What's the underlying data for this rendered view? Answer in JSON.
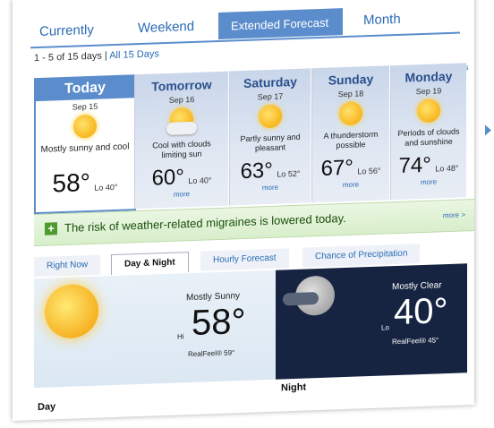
{
  "top_tabs": {
    "currently": "Currently",
    "weekend": "Weekend",
    "extended": "Extended Forecast",
    "month": "Month"
  },
  "subheader": {
    "range": "1 - 5 of 15 days",
    "sep": "|",
    "all": "All 15 Days"
  },
  "next5": "Next 5 days >",
  "days": [
    {
      "name": "Today",
      "date": "Sep 15",
      "desc": "Mostly sunny and cool",
      "hi": "58°",
      "lo": "Lo 40°",
      "more": ""
    },
    {
      "name": "Tomorrow",
      "date": "Sep 16",
      "desc": "Cool with clouds limiting sun",
      "hi": "60°",
      "lo": "Lo 40°",
      "more": "more"
    },
    {
      "name": "Saturday",
      "date": "Sep 17",
      "desc": "Partly sunny and pleasant",
      "hi": "63°",
      "lo": "Lo 52°",
      "more": "more"
    },
    {
      "name": "Sunday",
      "date": "Sep 18",
      "desc": "A thunderstorm possible",
      "hi": "67°",
      "lo": "Lo 56°",
      "more": "more"
    },
    {
      "name": "Monday",
      "date": "Sep 19",
      "desc": "Periods of clouds and sunshine",
      "hi": "74°",
      "lo": "Lo 48°",
      "more": "more"
    }
  ],
  "banner": {
    "plus": "+",
    "text": "The risk of weather-related migraines is lowered today.",
    "more": "more >"
  },
  "lower_tabs": [
    "Right Now",
    "Day & Night",
    "Hourly Forecast",
    "Chance of Precipitation"
  ],
  "day": {
    "cond": "Mostly Sunny",
    "hi_label": "Hi",
    "temp": "58°",
    "realfeel": "RealFeel® 59°",
    "label": "Day"
  },
  "night": {
    "cond": "Mostly Clear",
    "lo_label": "Lo",
    "temp": "40°",
    "realfeel": "RealFeel® 45°",
    "label": "Night"
  }
}
